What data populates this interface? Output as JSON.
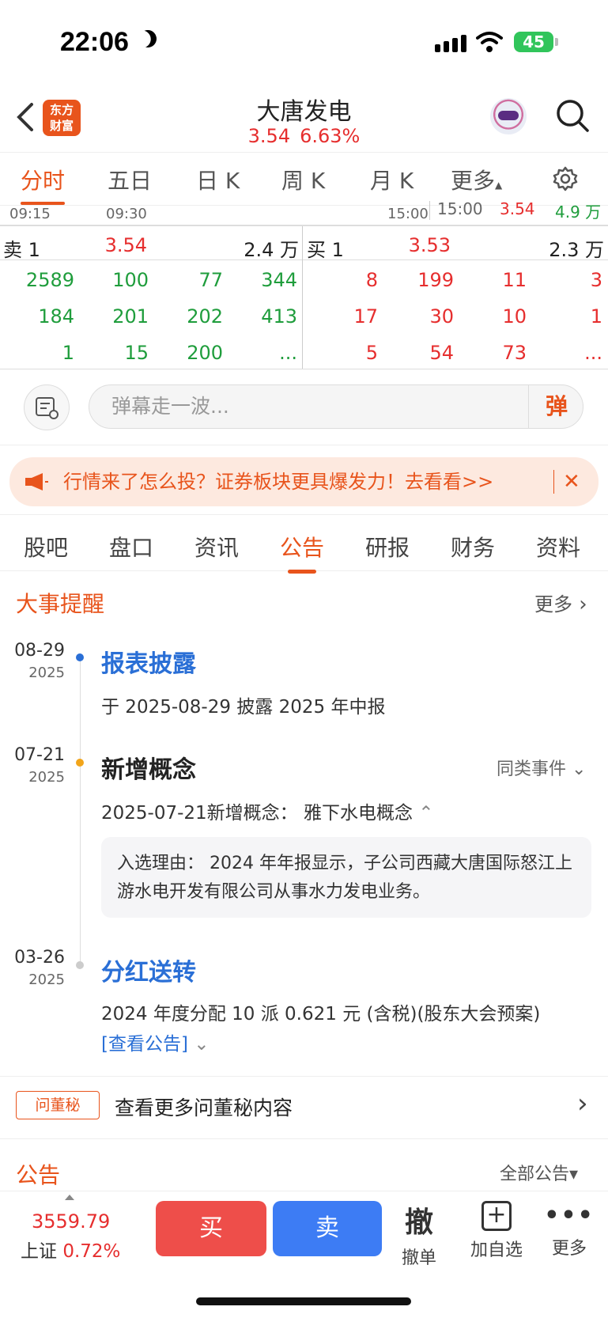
{
  "status_bar": {
    "time": "22:06",
    "battery": "45"
  },
  "header": {
    "logo_line1": "东方",
    "logo_line2": "财富",
    "title": "大唐发电",
    "price": "3.54",
    "change_pct": "6.63%"
  },
  "chart_tabs": [
    "分时",
    "五日",
    "日 K",
    "周 K",
    "月 K",
    "更多"
  ],
  "time_row": {
    "t1": "09:15",
    "t2": "09:30",
    "t3": "15:00",
    "tick_time": "15:00",
    "tick_price": "3.54",
    "tick_volume": "4.9 万"
  },
  "order_book": {
    "sell_label": "卖 1",
    "sell_price": "3.54",
    "sell_volume": "2.4 万",
    "buy_label": "买 1",
    "buy_price": "3.53",
    "buy_volume": "2.3 万",
    "sell_queue": [
      [
        "2589",
        "100",
        "77",
        "344"
      ],
      [
        "184",
        "201",
        "202",
        "413"
      ],
      [
        "1",
        "15",
        "200",
        "..."
      ]
    ],
    "buy_queue": [
      [
        "8",
        "199",
        "11",
        "3"
      ],
      [
        "17",
        "30",
        "10",
        "1"
      ],
      [
        "5",
        "54",
        "73",
        "..."
      ]
    ]
  },
  "danmu": {
    "placeholder": "弹幕走一波...",
    "button": "弹"
  },
  "banner": {
    "text": "行情来了怎么投？证券板块更具爆发力！去看看>>"
  },
  "info_tabs": [
    "股吧",
    "盘口",
    "资讯",
    "公告",
    "研报",
    "财务",
    "资料"
  ],
  "events_section": {
    "title": "大事提醒",
    "more": "更多",
    "events": [
      {
        "date": "08-29",
        "year": "2025",
        "title": "报表披露",
        "desc": "于 2025-08-29 披露 2025 年中报"
      },
      {
        "date": "07-21",
        "year": "2025",
        "title": "新增概念",
        "similar": "同类事件",
        "desc": "2025-07-21新增概念：  雅下水电概念",
        "reason": "入选理由：  2024 年年报显示，子公司西藏大唐国际怒江上游水电开发有限公司从事水力发电业务。"
      },
      {
        "date": "03-26",
        "year": "2025",
        "title": "分红送转",
        "desc": "2024 年度分配 10 派 0.621 元 (含税)(股东大会预案)",
        "link": "[查看公告]"
      }
    ]
  },
  "dongmi": {
    "tag": "问董秘",
    "text": "查看更多问董秘内容"
  },
  "announcements": {
    "title": "公告",
    "all": "全部公告"
  },
  "bottom_bar": {
    "index_value": "3559.79",
    "index_name": "上证",
    "index_change": "0.72%",
    "buy": "买",
    "sell": "卖",
    "cancel_glyph": "撤",
    "cancel": "撤单",
    "add": "加自选",
    "more": "更多"
  },
  "colors": {
    "accent": "#e8541c",
    "up": "#e62e2e",
    "down": "#1f9d3c",
    "sell_btn": "#3d7cf4",
    "buy_btn": "#ee4e4a"
  }
}
